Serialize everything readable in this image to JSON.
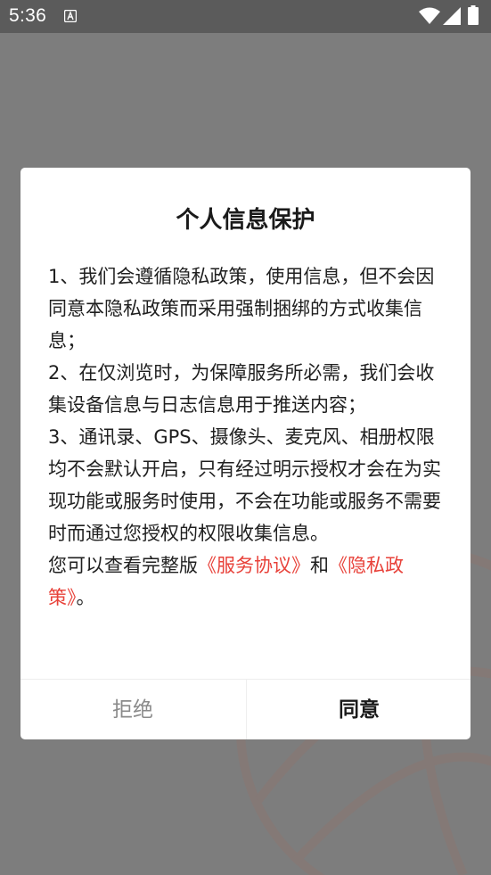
{
  "status_bar": {
    "time": "5:36"
  },
  "dialog": {
    "title": "个人信息保护",
    "item1": "1、我们会遵循隐私政策，使用信息，但不会因同意本隐私政策而采用强制捆绑的方式收集信息；",
    "item2": "2、在仅浏览时，为保障服务所必需，我们会收集设备信息与日志信息用于推送内容；",
    "item3": "3、通讯录、GPS、摄像头、麦克风、相册权限均不会默认开启，只有经过明示授权才会在为实现功能或服务时使用，不会在功能或服务不需要时而通过您授权的权限收集信息。",
    "notice_prefix": "您可以查看完整版",
    "service_link": "《服务协议》",
    "notice_and": "和",
    "privacy_link": "《隐私政策》",
    "notice_suffix": "。",
    "reject_label": "拒绝",
    "agree_label": "同意"
  },
  "colors": {
    "link": "#e8423a",
    "overlay": "#7d7d7d",
    "status_bar": "#5b5b5b"
  },
  "icons": [
    "notification-a-icon",
    "wifi-icon",
    "signal-icon",
    "battery-icon"
  ]
}
